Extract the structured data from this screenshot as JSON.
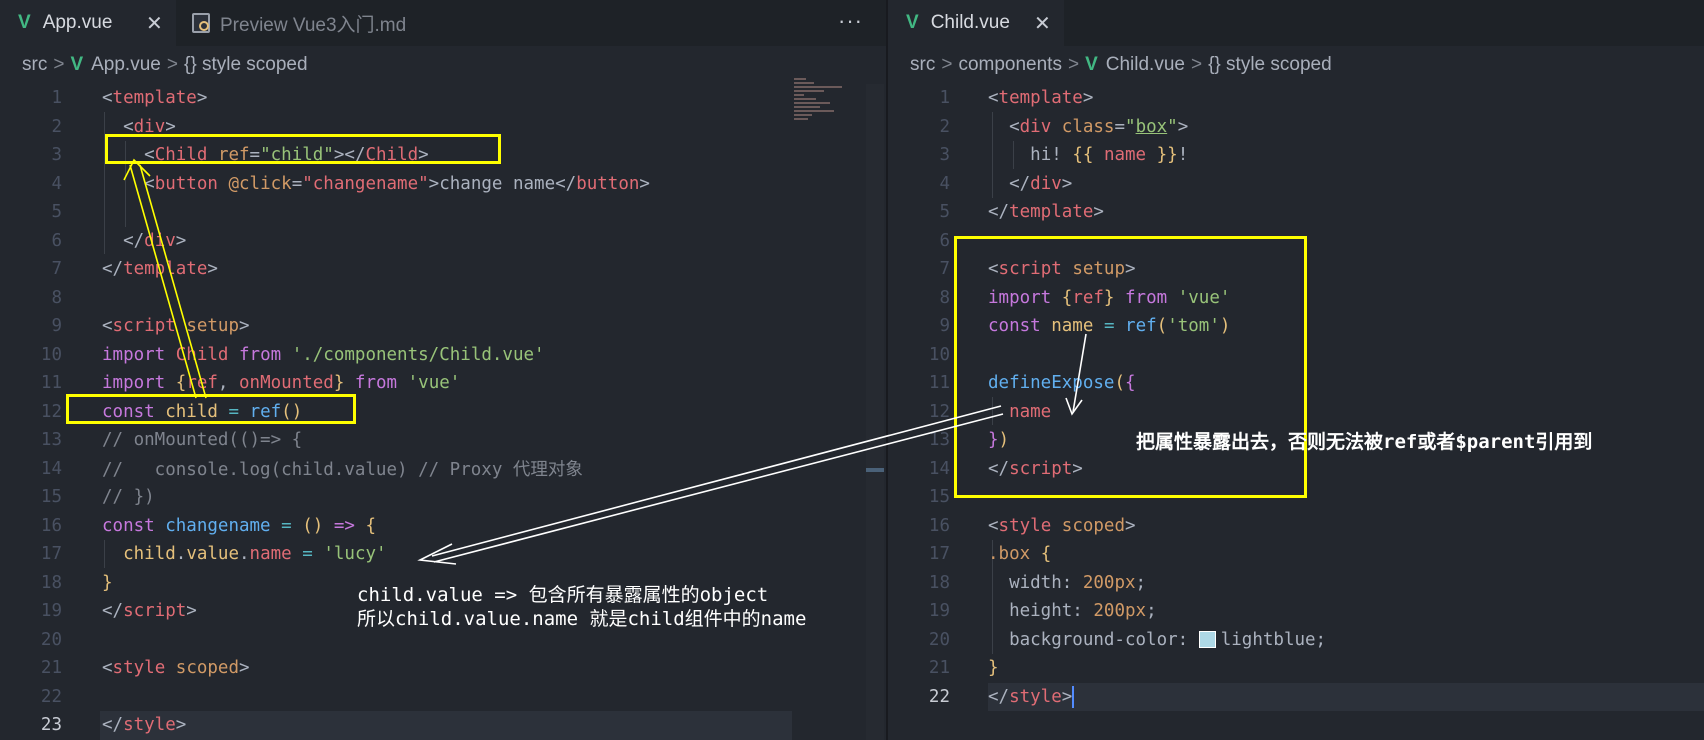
{
  "left": {
    "tabs": [
      {
        "label": "App.vue",
        "icon": "vue-icon",
        "close": "✕"
      },
      {
        "label": "Preview Vue3入门.md",
        "icon": "preview-icon"
      }
    ],
    "more": "···",
    "breadcrumb": [
      "src",
      "App.vue",
      "{} style scoped"
    ],
    "lines": [
      {
        "n": "1"
      },
      {
        "n": "2"
      },
      {
        "n": "3"
      },
      {
        "n": "4"
      },
      {
        "n": "5"
      },
      {
        "n": "6"
      },
      {
        "n": "7"
      },
      {
        "n": "8"
      },
      {
        "n": "9"
      },
      {
        "n": "10"
      },
      {
        "n": "11"
      },
      {
        "n": "12"
      },
      {
        "n": "13"
      },
      {
        "n": "14"
      },
      {
        "n": "15"
      },
      {
        "n": "16"
      },
      {
        "n": "17"
      },
      {
        "n": "18"
      },
      {
        "n": "19"
      },
      {
        "n": "20"
      },
      {
        "n": "21"
      },
      {
        "n": "22"
      },
      {
        "n": "23"
      }
    ],
    "annotation": "child.value => 包含所有暴露属性的object\n所以child.value.name 就是child组件中的name"
  },
  "right": {
    "tabs": [
      {
        "label": "Child.vue",
        "icon": "vue-icon",
        "close": "✕"
      }
    ],
    "breadcrumb": [
      "src",
      "components",
      "Child.vue",
      "{} style scoped"
    ],
    "lines": [
      {
        "n": "1"
      },
      {
        "n": "2"
      },
      {
        "n": "3"
      },
      {
        "n": "4"
      },
      {
        "n": "5"
      },
      {
        "n": "6"
      },
      {
        "n": "7"
      },
      {
        "n": "8"
      },
      {
        "n": "9"
      },
      {
        "n": "10"
      },
      {
        "n": "11"
      },
      {
        "n": "12"
      },
      {
        "n": "13"
      },
      {
        "n": "14"
      },
      {
        "n": "15"
      },
      {
        "n": "16"
      },
      {
        "n": "17"
      },
      {
        "n": "18"
      },
      {
        "n": "19"
      },
      {
        "n": "20"
      },
      {
        "n": "21"
      },
      {
        "n": "22"
      }
    ],
    "annotation": "把属性暴露出去，否则无法被ref或者$parent引用到",
    "swatch_color": "#add8e6"
  },
  "colors": {
    "highlight": "#ffff00",
    "vue_green": "#42b883",
    "annotation": "#ffffff"
  }
}
